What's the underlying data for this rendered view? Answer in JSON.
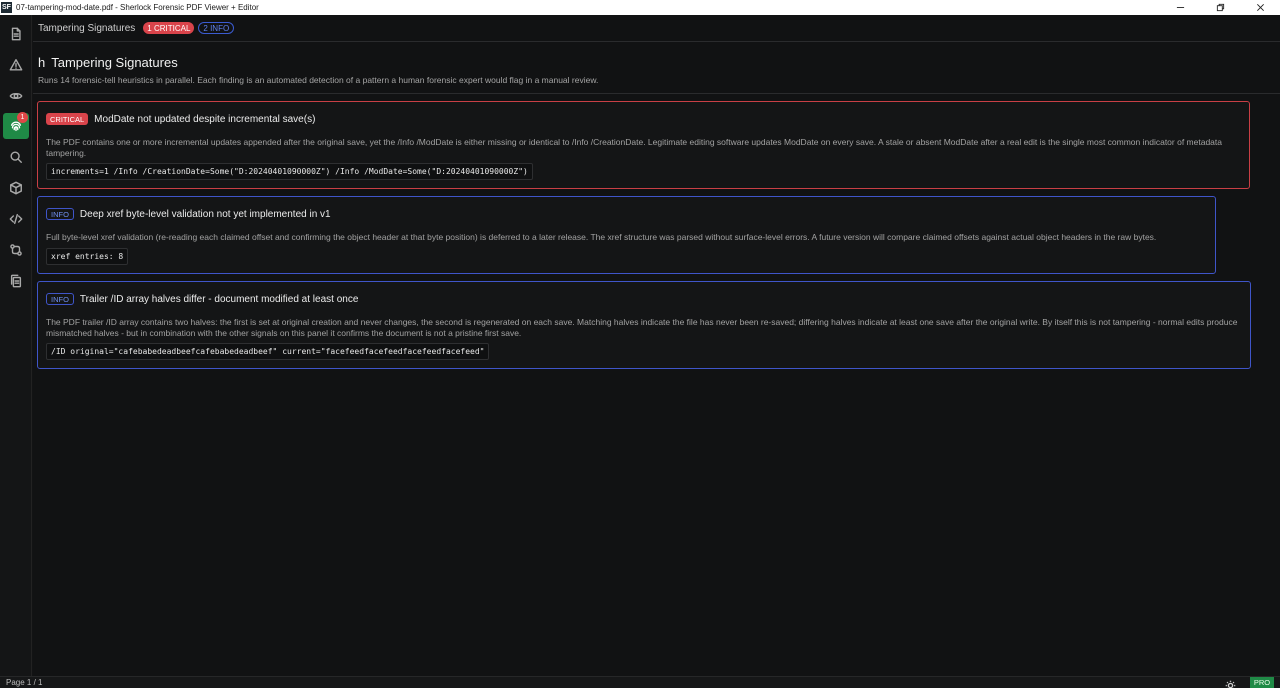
{
  "window": {
    "app_logo": "SF",
    "title": "07-tampering-mod-date.pdf - Sherlock Forensic PDF Viewer + Editor"
  },
  "sidebar": {
    "items": [
      {
        "icon": "document-icon"
      },
      {
        "icon": "warning-triangle-icon"
      },
      {
        "icon": "eye-icon"
      },
      {
        "icon": "fingerprint-icon",
        "badge": "1",
        "active": true
      },
      {
        "icon": "search-icon"
      },
      {
        "icon": "cube-icon"
      },
      {
        "icon": "code-icon"
      },
      {
        "icon": "git-compare-icon"
      },
      {
        "icon": "copy-document-icon"
      }
    ]
  },
  "tabbar": {
    "title": "Tampering Signatures",
    "critical_pill": "1 CRITICAL",
    "info_pill": "2 INFO"
  },
  "section": {
    "icon_glyph": "h",
    "title": "Tampering Signatures",
    "description": "Runs 14 forensic-tell heuristics in parallel. Each finding is an automated detection of a pattern a human forensic expert would flag in a manual review."
  },
  "findings": [
    {
      "severity": "CRITICAL",
      "title": "ModDate not updated despite incremental save(s)",
      "body": "The PDF contains one or more incremental updates appended after the original save, yet the /Info /ModDate is either missing or identical to /Info /CreationDate. Legitimate editing software updates ModDate on every save. A stale or absent ModDate after a real edit is the single most common indicator of metadata tampering.",
      "evidence": "increments=1 /Info /CreationDate=Some(\"D:20240401090000Z\") /Info /ModDate=Some(\"D:20240401090000Z\")"
    },
    {
      "severity": "INFO",
      "title": "Deep xref byte-level validation not yet implemented in v1",
      "body": "Full byte-level xref validation (re-reading each claimed offset and confirming the object header at that byte position) is deferred to a later release. The xref structure was parsed without surface-level errors. A future version will compare claimed offsets against actual object headers in the raw bytes.",
      "evidence": "xref entries: 8"
    },
    {
      "severity": "INFO",
      "title": "Trailer /ID array halves differ - document modified at least once",
      "body": "The PDF trailer /ID array contains two halves: the first is set at original creation and never changes, the second is regenerated on each save. Matching halves indicate the file has never been re-saved; differing halves indicate at least one save after the original write. By itself this is not tampering - normal edits produce mismatched halves - but in combination with the other signals on this panel it confirms the document is not a pristine first save.",
      "evidence": "/ID original=\"cafebabedeadbeefcafebabedeadbeef\" current=\"facefeedfacefeedfacefeedfacefeed\""
    }
  ],
  "statusbar": {
    "page": "Page 1 / 1",
    "pro_badge": "PRO"
  },
  "colors": {
    "critical": "#d9444b",
    "info": "#3f55c9",
    "active_green": "#1f8a46",
    "background": "#121314"
  }
}
